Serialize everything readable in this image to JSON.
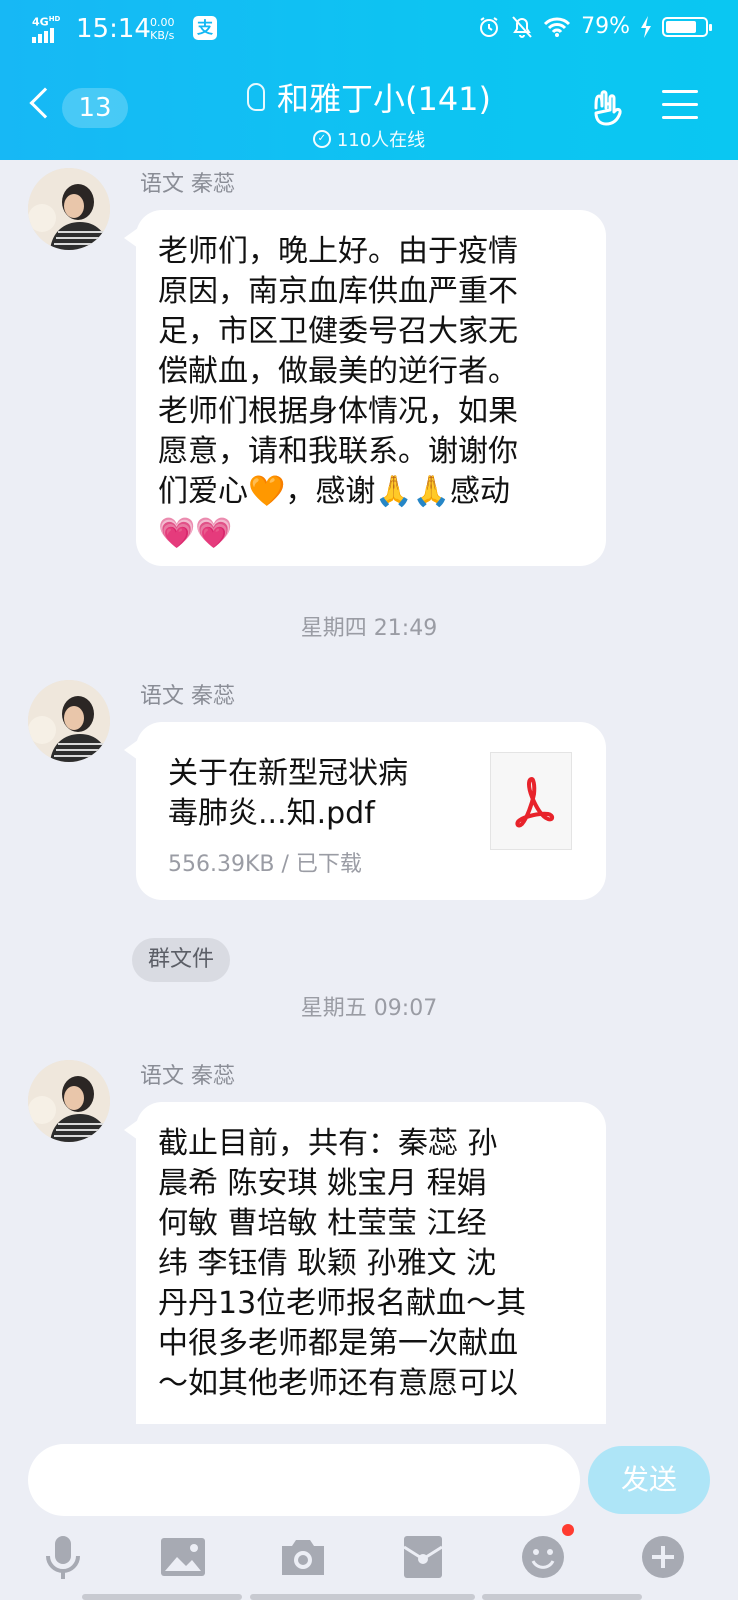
{
  "status_bar": {
    "network": "4G",
    "network_sup": "HD",
    "time": "15:14",
    "speed_value": "0.00",
    "speed_unit": "KB/s",
    "alipay_icon": "支",
    "battery_text": "79%",
    "battery_level": 0.79
  },
  "header": {
    "back_count": "13",
    "title": "和雅丁小(141)",
    "online_text": "110人在线",
    "icons": [
      "back-chevron-icon",
      "ear-icon",
      "hand-gesture-icon",
      "menu-icon"
    ]
  },
  "messages": [
    {
      "sender": "语文  秦蕊",
      "lines": [
        "老师们，晚上好。由于疫情",
        "原因，南京血库供血严重不",
        "足，市区卫健委号召大家无",
        "偿献血，做最美的逆行者。",
        "老师们根据身体情况，如果",
        "愿意，请和我联系。谢谢你"
      ],
      "line_emoji1": "们爱心🧡，感谢🙏🙏感动",
      "line_emoji2": "💗💗"
    },
    {
      "timestamp": "星期四 21:49",
      "sender": "语文  秦蕊",
      "file_title_line1": "关于在新型冠状病",
      "file_title_line2": "毒肺炎...知.pdf",
      "file_size": "556.39KB / 已下载",
      "tag": "群文件"
    },
    {
      "timestamp": "星期五 09:07",
      "sender": "语文  秦蕊",
      "lines": [
        "截止目前，共有：秦蕊   孙",
        "晨希  陈安琪  姚宝月    程娟",
        "何敏  曹培敏  杜莹莹  江经",
        "纬  李钰倩  耿颖  孙雅文 沈",
        "丹丹13位老师报名献血～其",
        "中很多老师都是第一次献血",
        "～如其他老师还有意愿可以"
      ]
    }
  ],
  "input": {
    "placeholder": "",
    "send_label": "发送"
  },
  "toolbar": [
    "microphone-icon",
    "image-icon",
    "camera-icon",
    "red-packet-icon",
    "emoji-icon",
    "plus-icon"
  ],
  "colors": {
    "header_start": "#17b8f5",
    "header_end": "#0ac7f2",
    "background": "#eceef5",
    "send_button": "#aee5f7",
    "notification_dot": "#ff3b30"
  }
}
